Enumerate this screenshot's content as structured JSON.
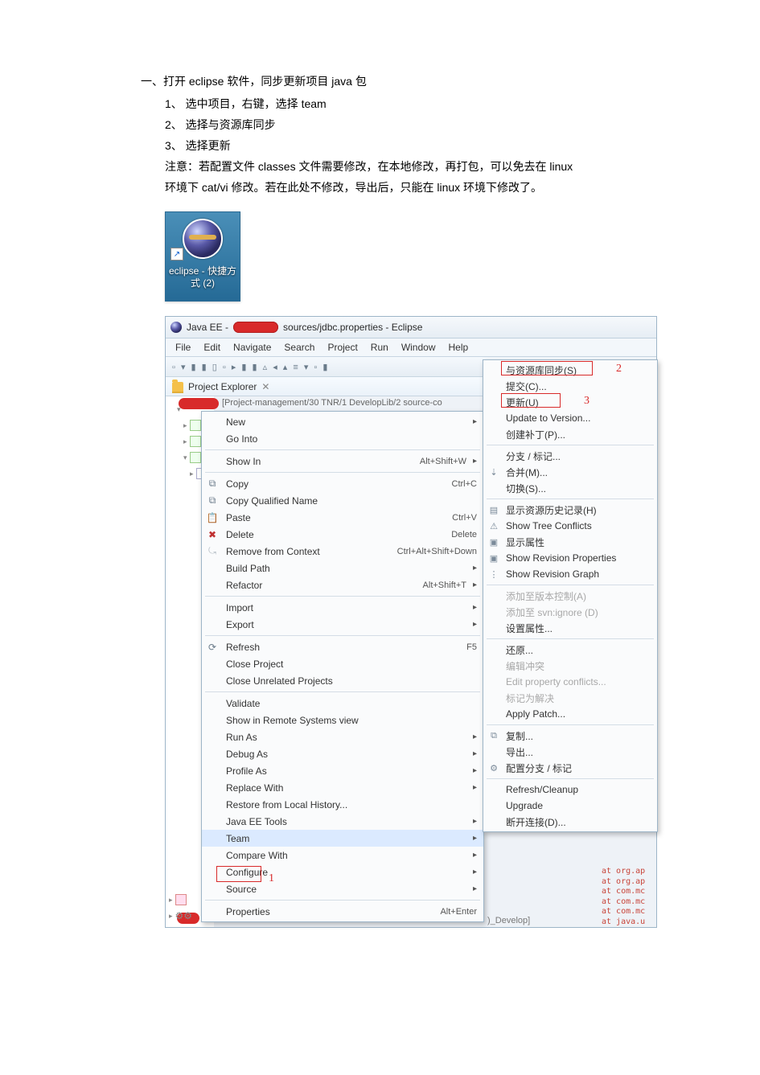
{
  "heading": "一、打开 eclipse  软件，同步更新项目 java 包",
  "steps": {
    "s1": "1、 选中项目，右键，选择 team",
    "s2": "2、 选择与资源库同步",
    "s3": "3、 选择更新",
    "note1": "注意：若配置文件 classes 文件需要修改，在本地修改，再打包，可以免去在 linux",
    "note2": "环境下 cat/vi 修改。若在此处不修改，导出后，只能在 linux 环境下修改了。"
  },
  "desktopIcon": "eclipse - 快捷方式 (2)",
  "titlebar": {
    "prefix": "Java EE -",
    "suffix": "sources/jdbc.properties - Eclipse"
  },
  "menubar": [
    "File",
    "Edit",
    "Navigate",
    "Search",
    "Project",
    "Run",
    "Window",
    "Help"
  ],
  "explorerTitle": "Project Explorer",
  "treePath": "[Project-management/30 TNR/1 DevelopLib/2 source-co",
  "contextMenu": [
    {
      "label": "New",
      "arrow": true
    },
    {
      "label": "Go Into"
    },
    {
      "sep": true
    },
    {
      "label": "Show In",
      "accel": "Alt+Shift+W",
      "arrow": true
    },
    {
      "sep": true
    },
    {
      "icon": "⧉",
      "label": "Copy",
      "accel": "Ctrl+C"
    },
    {
      "icon": "⧉",
      "label": "Copy Qualified Name"
    },
    {
      "icon": "📋",
      "label": "Paste",
      "accel": "Ctrl+V"
    },
    {
      "icon": "✖",
      "label": "Delete",
      "accel": "Delete",
      "iconColor": "#c03030"
    },
    {
      "icon": "⤿",
      "label": "Remove from Context",
      "accel": "Ctrl+Alt+Shift+Down",
      "faded": true
    },
    {
      "label": "Build Path",
      "arrow": true
    },
    {
      "label": "Refactor",
      "accel": "Alt+Shift+T",
      "arrow": true
    },
    {
      "sep": true
    },
    {
      "label": "Import",
      "arrow": true
    },
    {
      "label": "Export",
      "arrow": true
    },
    {
      "sep": true
    },
    {
      "icon": "⟳",
      "label": "Refresh",
      "accel": "F5"
    },
    {
      "label": "Close Project"
    },
    {
      "label": "Close Unrelated Projects"
    },
    {
      "sep": true
    },
    {
      "label": "Validate"
    },
    {
      "label": "Show in Remote Systems view"
    },
    {
      "label": "Run As",
      "arrow": true
    },
    {
      "label": "Debug As",
      "arrow": true
    },
    {
      "label": "Profile As",
      "arrow": true
    },
    {
      "label": "Replace With",
      "arrow": true
    },
    {
      "label": "Restore from Local History..."
    },
    {
      "label": "Java EE Tools",
      "arrow": true
    },
    {
      "label": "Team",
      "arrow": true,
      "highlight": true
    },
    {
      "label": "Compare With",
      "arrow": true
    },
    {
      "label": "Configure",
      "arrow": true
    },
    {
      "label": "Source",
      "arrow": true
    },
    {
      "sep": true
    },
    {
      "label": "Properties",
      "accel": "Alt+Enter"
    }
  ],
  "teamSubmenu": [
    {
      "label": "与资源库同步(S)"
    },
    {
      "label": "提交(C)..."
    },
    {
      "label": "更新(U)"
    },
    {
      "label": "Update to Version..."
    },
    {
      "label": "创建补丁(P)..."
    },
    {
      "sep": true
    },
    {
      "label": "分支 / 标记..."
    },
    {
      "icon": "⇣",
      "label": "合并(M)..."
    },
    {
      "label": "切换(S)..."
    },
    {
      "sep": true
    },
    {
      "icon": "▤",
      "label": "显示资源历史记录(H)"
    },
    {
      "icon": "⚠",
      "label": "Show Tree Conflicts"
    },
    {
      "icon": "▣",
      "label": "显示属性"
    },
    {
      "icon": "▣",
      "label": "Show Revision Properties"
    },
    {
      "icon": "⋮",
      "label": "Show Revision Graph"
    },
    {
      "sep": true
    },
    {
      "label": "添加至版本控制(A)",
      "disabled": true
    },
    {
      "label": "添加至 svn:ignore (D)",
      "disabled": true
    },
    {
      "label": "设置属性..."
    },
    {
      "sep": true
    },
    {
      "label": "还原..."
    },
    {
      "label": "编辑冲突",
      "disabled": true
    },
    {
      "label": "Edit property conflicts...",
      "disabled": true
    },
    {
      "label": "标记为解决",
      "disabled": true
    },
    {
      "label": "Apply Patch..."
    },
    {
      "sep": true
    },
    {
      "icon": "⧉",
      "label": "复制..."
    },
    {
      "label": "导出..."
    },
    {
      "icon": "⚙",
      "label": "配置分支 / 标记"
    },
    {
      "sep": true
    },
    {
      "label": "Refresh/Cleanup"
    },
    {
      "label": "Upgrade"
    },
    {
      "label": "断开连接(D)..."
    }
  ],
  "annotations": {
    "n1": "1",
    "n2": "2",
    "n3": "3"
  },
  "devTag": ")_Develop]",
  "stack": [
    "at org.ap",
    "at org.ap",
    "at com.mc",
    "at com.mc",
    "at com.mc",
    "at java.u"
  ]
}
